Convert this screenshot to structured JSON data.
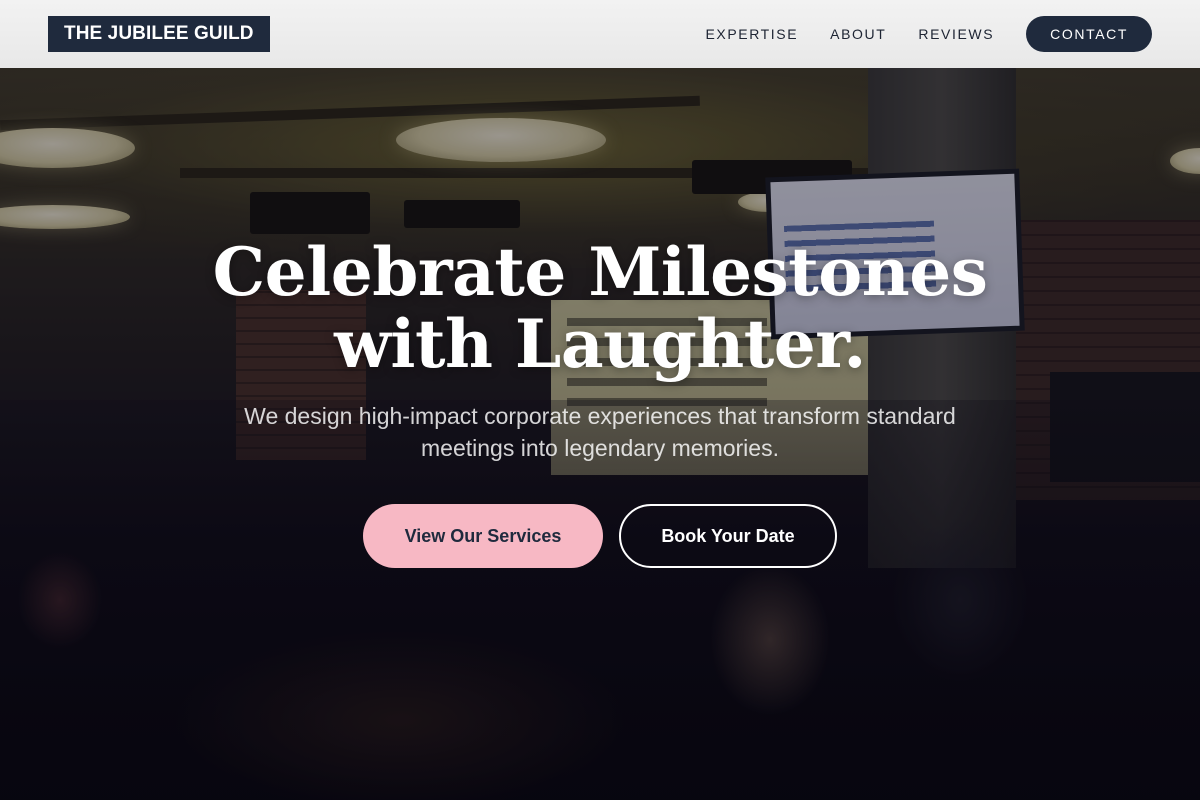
{
  "header": {
    "logo_text": "THE JUBILEE GUILD",
    "nav": [
      {
        "label": "EXPERTISE"
      },
      {
        "label": "ABOUT"
      },
      {
        "label": "REVIEWS"
      }
    ],
    "cta_label": "CONTACT"
  },
  "hero": {
    "headline_line1": "Celebrate Milestones",
    "headline_line2": "with Laughter.",
    "subtitle": "We design high-impact corporate experiences that transform standard meetings into legendary memories.",
    "primary_button": "View Our Services",
    "secondary_button": "Book Your Date"
  },
  "colors": {
    "brand_navy": "#1f2a3d",
    "accent_pink": "#f7b8c4",
    "header_bg": "#eeeeee"
  }
}
